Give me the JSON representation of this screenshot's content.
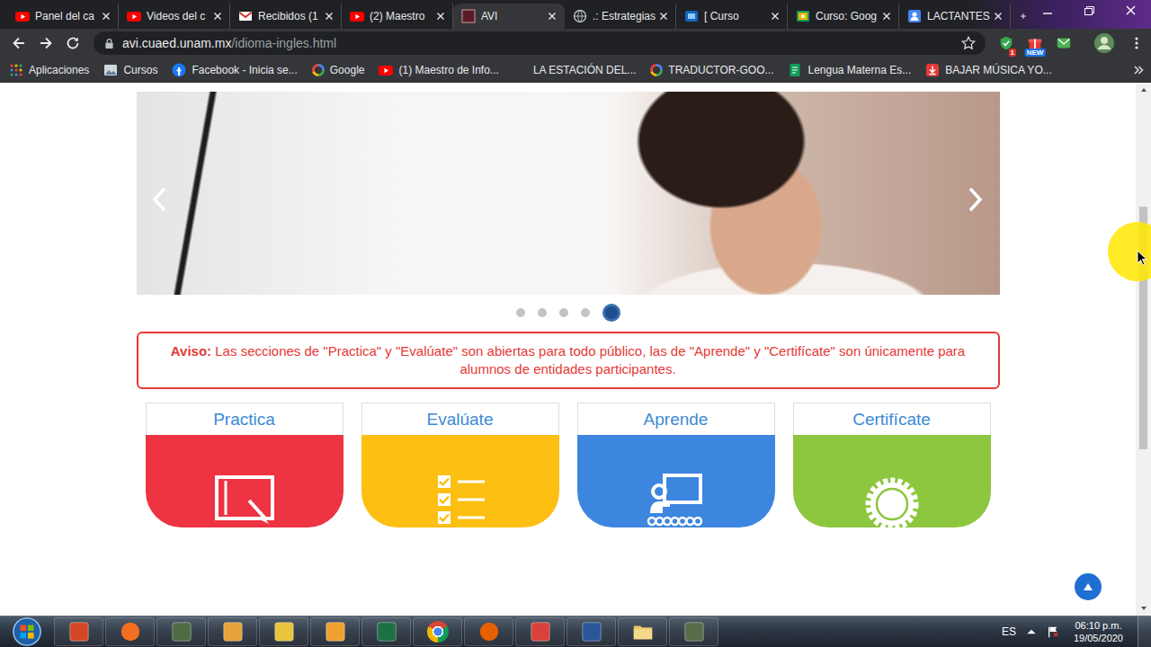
{
  "browser": {
    "tabs": [
      {
        "label": "Panel del ca",
        "kind": "youtube",
        "selected": false
      },
      {
        "label": "Videos del c",
        "kind": "youtube",
        "selected": false
      },
      {
        "label": "Recibidos (1",
        "kind": "gmail",
        "selected": false
      },
      {
        "label": "(2) Maestro",
        "kind": "youtube",
        "selected": false
      },
      {
        "label": "AVI",
        "kind": "avi",
        "selected": true
      },
      {
        "label": ".: Estrategias",
        "kind": "globe",
        "selected": false
      },
      {
        "label": "[ Curso",
        "kind": "course",
        "selected": false
      },
      {
        "label": "Curso: Goog",
        "kind": "classroom",
        "selected": false
      },
      {
        "label": "LACTANTES",
        "kind": "people",
        "selected": false
      }
    ],
    "address": {
      "host": "avi.cuaed.unam.mx",
      "path": "/idioma-ingles.html",
      "bookmarked": false
    },
    "extensions": [
      {
        "kind": "shield",
        "badge": "1"
      },
      {
        "kind": "gift",
        "badge": "NEW"
      },
      {
        "kind": "mail"
      }
    ],
    "bookmarks": [
      {
        "label": "Aplicaciones",
        "kind": "apps"
      },
      {
        "label": "Cursos",
        "kind": "image"
      },
      {
        "label": "Facebook - Inicia se...",
        "kind": "facebook"
      },
      {
        "label": "Google",
        "kind": "google"
      },
      {
        "label": "(1) Maestro de Info...",
        "kind": "youtube"
      },
      {
        "label": "LA ESTACIÓN DEL...",
        "kind": "blank"
      },
      {
        "label": "TRADUCTOR-GOO...",
        "kind": "google"
      },
      {
        "label": "Lengua Materna Es...",
        "kind": "doc"
      },
      {
        "label": "BAJAR MÚSICA YO...",
        "kind": "download"
      }
    ]
  },
  "page": {
    "slides": [
      {
        "selected": false
      },
      {
        "selected": false
      },
      {
        "selected": false
      },
      {
        "selected": false
      },
      {
        "selected": true
      }
    ],
    "notice": {
      "label": "Aviso:",
      "text": "Las secciones de \"Practica\" y \"Evalúate\" son abiertas para todo público, las de \"Aprende\" y \"Certifícate\" son únicamente para alumnos de entidades participantes."
    },
    "cards": [
      {
        "title": "Practica",
        "color": "#ee3342",
        "kind": "tablet"
      },
      {
        "title": "Evalúate",
        "color": "#fcbf12",
        "kind": "checklist"
      },
      {
        "title": "Aprende",
        "color": "#3d86df",
        "kind": "classroom"
      },
      {
        "title": "Certifícate",
        "color": "#8dc63f",
        "kind": "seal"
      }
    ]
  },
  "taskbar": {
    "apps": [
      {
        "kind": "tile",
        "color": "#d24726"
      },
      {
        "kind": "round",
        "color": "#f26f21"
      },
      {
        "kind": "tile",
        "color": "#4f6b45"
      },
      {
        "kind": "tile",
        "color": "#e6a23c"
      },
      {
        "kind": "tile",
        "color": "#e8c53a"
      },
      {
        "kind": "tile",
        "color": "#f0a030"
      },
      {
        "kind": "tile",
        "color": "#1d7044"
      },
      {
        "kind": "chrome",
        "color": "#4285f4"
      },
      {
        "kind": "round",
        "color": "#e66000"
      },
      {
        "kind": "tile",
        "color": "#d9413a"
      },
      {
        "kind": "tile",
        "color": "#2b579a"
      },
      {
        "kind": "folder",
        "color": "#e8c66a"
      },
      {
        "kind": "tile",
        "color": "#5a6b4a"
      }
    ],
    "language": "ES",
    "time": "06:10 p.m.",
    "date": "19/05/2020"
  }
}
